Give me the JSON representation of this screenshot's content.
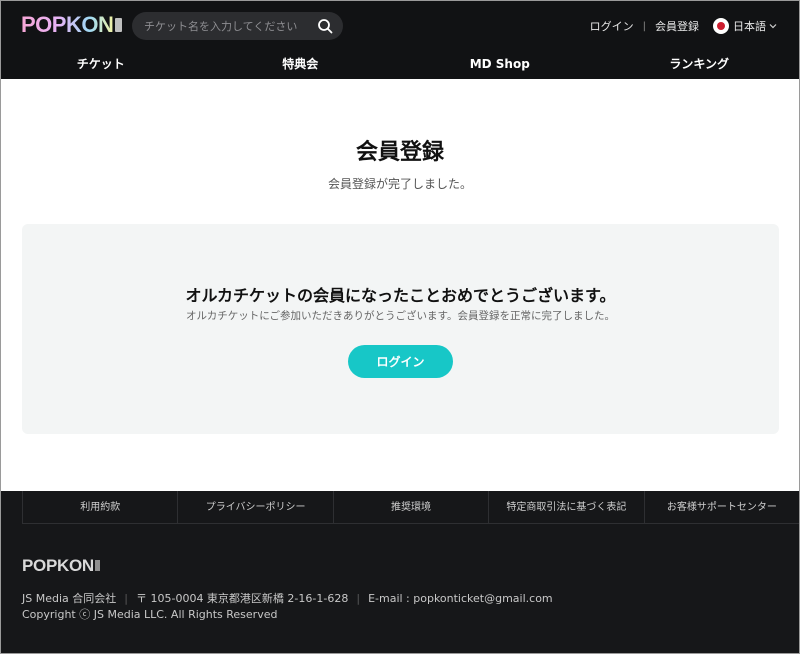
{
  "header": {
    "logo": "POPKON",
    "search_placeholder": "チケット名を入力してください",
    "login_link": "ログイン",
    "separator": "|",
    "register_link": "会員登録",
    "language": "日本語",
    "nav": [
      "チケット",
      "特典会",
      "MD Shop",
      "ランキング"
    ]
  },
  "main": {
    "title": "会員登録",
    "subtitle": "会員登録が完了しました。",
    "panel_heading": "オルカチケットの会員になったことおめでとうございます。",
    "panel_text": "オルカチケットにご参加いただきありがとうございます。会員登録を正常に完了しました。",
    "login_button": "ログイン"
  },
  "footer": {
    "links": [
      "利用約款",
      "プライバシーポリシー",
      "推奨環境",
      "特定商取引法に基づく表記",
      "お客様サポートセンター"
    ],
    "logo": "POPKON",
    "company": "JS Media 合同会社",
    "address": "〒 105-0004 東京都港区新橋 2-16-1-628",
    "email": "E-mail : popkonticket@gmail.com",
    "copyright": "Copyright ⓒ JS Media LLC. All Rights Reserved"
  },
  "colors": {
    "header_bg": "#111214",
    "accent": "#17c7c7",
    "panel_bg": "#f3f5f5",
    "footer_bg": "#161719"
  }
}
